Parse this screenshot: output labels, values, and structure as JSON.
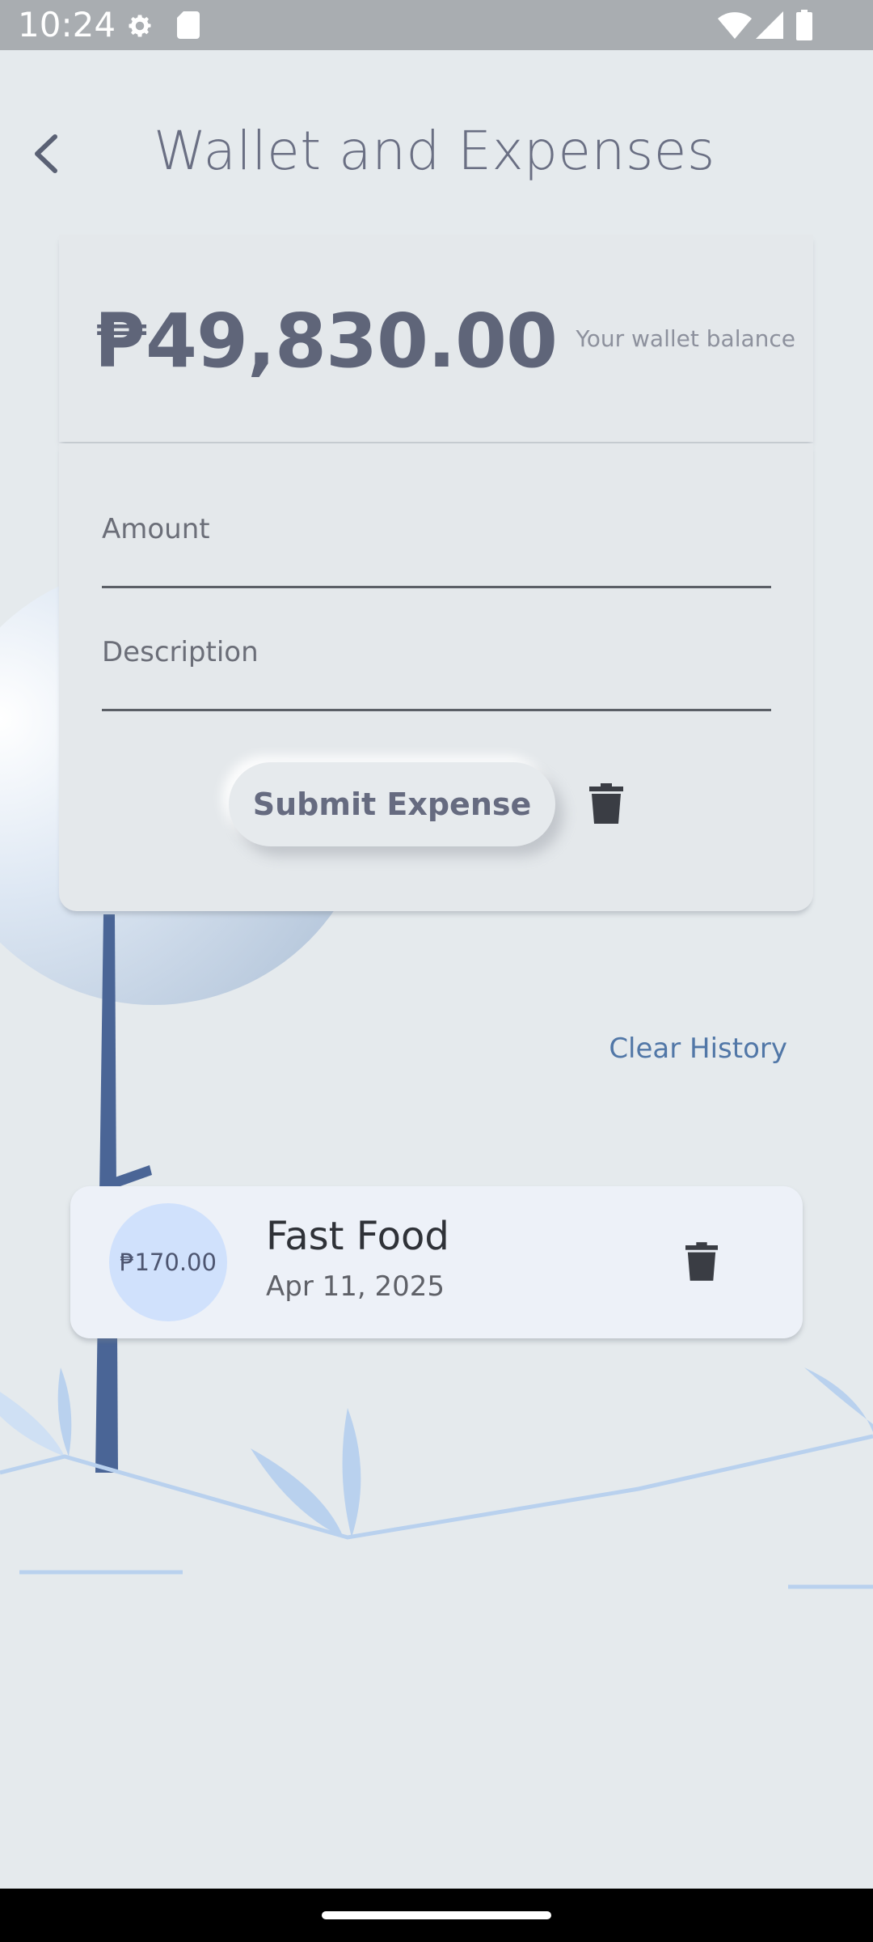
{
  "status_bar": {
    "time": "10:24",
    "icons": [
      "gear-icon",
      "sd-card-icon",
      "wifi-icon",
      "signal-icon",
      "battery-icon"
    ]
  },
  "header": {
    "title": "Wallet and Expenses",
    "back_icon": "chevron-left-icon"
  },
  "balance": {
    "amount": "₱49,830.00",
    "label": "Your wallet balance"
  },
  "form": {
    "amount_placeholder": "Amount",
    "description_placeholder": "Description",
    "submit_label": "Submit Expense",
    "delete_icon": "trash-icon"
  },
  "history": {
    "clear_label": "Clear History",
    "items": [
      {
        "amount": "₱170.00",
        "title": "Fast Food",
        "date": "Apr 11, 2025"
      }
    ]
  },
  "colors": {
    "background": "#e5eaed",
    "accent": "#5177a7",
    "text_primary": "#5f6579",
    "amount_circle": "#d0e1fc"
  }
}
